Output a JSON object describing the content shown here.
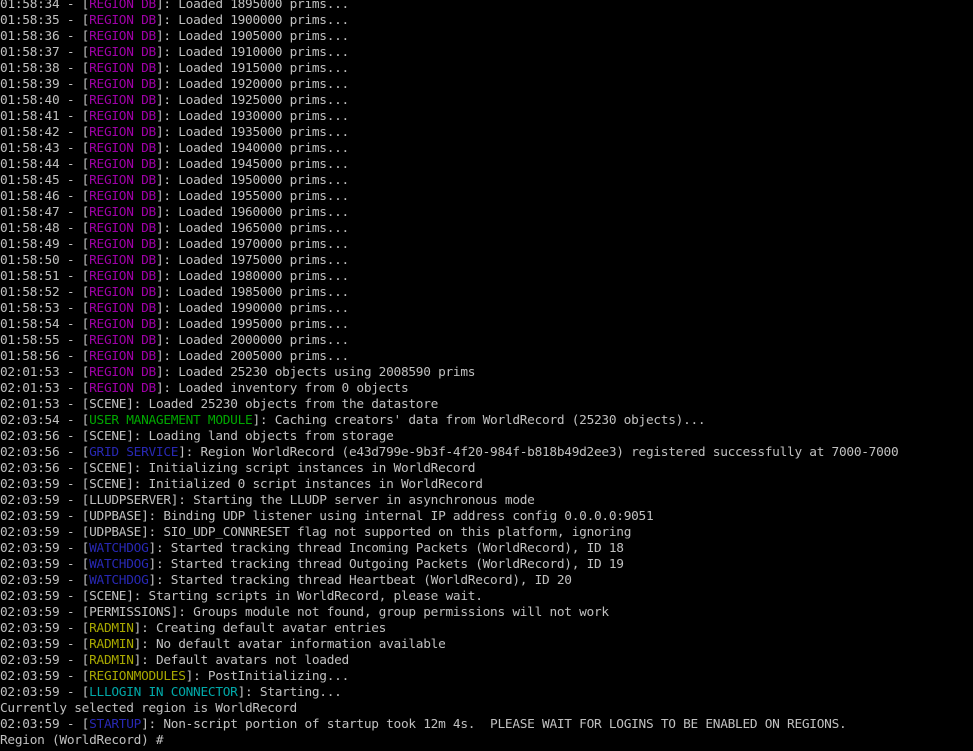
{
  "window": {
    "background": "#000000",
    "default_text_color": "#c0c0c0"
  },
  "colors": {
    "default": "#c0c0c0",
    "purple": "#a000a8",
    "green": "#00a800",
    "blue": "#2828b4",
    "yellow": "#a8a800",
    "teal": "#00a8a8"
  },
  "lines": [
    {
      "time": "01:58:34",
      "tag": "REGION DB",
      "tag_color": "purple",
      "msg": ": Loaded 1895000 prims..."
    },
    {
      "time": "01:58:35",
      "tag": "REGION DB",
      "tag_color": "purple",
      "msg": ": Loaded 1900000 prims..."
    },
    {
      "time": "01:58:36",
      "tag": "REGION DB",
      "tag_color": "purple",
      "msg": ": Loaded 1905000 prims..."
    },
    {
      "time": "01:58:37",
      "tag": "REGION DB",
      "tag_color": "purple",
      "msg": ": Loaded 1910000 prims..."
    },
    {
      "time": "01:58:38",
      "tag": "REGION DB",
      "tag_color": "purple",
      "msg": ": Loaded 1915000 prims..."
    },
    {
      "time": "01:58:39",
      "tag": "REGION DB",
      "tag_color": "purple",
      "msg": ": Loaded 1920000 prims..."
    },
    {
      "time": "01:58:40",
      "tag": "REGION DB",
      "tag_color": "purple",
      "msg": ": Loaded 1925000 prims..."
    },
    {
      "time": "01:58:41",
      "tag": "REGION DB",
      "tag_color": "purple",
      "msg": ": Loaded 1930000 prims..."
    },
    {
      "time": "01:58:42",
      "tag": "REGION DB",
      "tag_color": "purple",
      "msg": ": Loaded 1935000 prims..."
    },
    {
      "time": "01:58:43",
      "tag": "REGION DB",
      "tag_color": "purple",
      "msg": ": Loaded 1940000 prims..."
    },
    {
      "time": "01:58:44",
      "tag": "REGION DB",
      "tag_color": "purple",
      "msg": ": Loaded 1945000 prims..."
    },
    {
      "time": "01:58:45",
      "tag": "REGION DB",
      "tag_color": "purple",
      "msg": ": Loaded 1950000 prims..."
    },
    {
      "time": "01:58:46",
      "tag": "REGION DB",
      "tag_color": "purple",
      "msg": ": Loaded 1955000 prims..."
    },
    {
      "time": "01:58:47",
      "tag": "REGION DB",
      "tag_color": "purple",
      "msg": ": Loaded 1960000 prims..."
    },
    {
      "time": "01:58:48",
      "tag": "REGION DB",
      "tag_color": "purple",
      "msg": ": Loaded 1965000 prims..."
    },
    {
      "time": "01:58:49",
      "tag": "REGION DB",
      "tag_color": "purple",
      "msg": ": Loaded 1970000 prims..."
    },
    {
      "time": "01:58:50",
      "tag": "REGION DB",
      "tag_color": "purple",
      "msg": ": Loaded 1975000 prims..."
    },
    {
      "time": "01:58:51",
      "tag": "REGION DB",
      "tag_color": "purple",
      "msg": ": Loaded 1980000 prims..."
    },
    {
      "time": "01:58:52",
      "tag": "REGION DB",
      "tag_color": "purple",
      "msg": ": Loaded 1985000 prims..."
    },
    {
      "time": "01:58:53",
      "tag": "REGION DB",
      "tag_color": "purple",
      "msg": ": Loaded 1990000 prims..."
    },
    {
      "time": "01:58:54",
      "tag": "REGION DB",
      "tag_color": "purple",
      "msg": ": Loaded 1995000 prims..."
    },
    {
      "time": "01:58:55",
      "tag": "REGION DB",
      "tag_color": "purple",
      "msg": ": Loaded 2000000 prims..."
    },
    {
      "time": "01:58:56",
      "tag": "REGION DB",
      "tag_color": "purple",
      "msg": ": Loaded 2005000 prims..."
    },
    {
      "time": "02:01:53",
      "tag": "REGION DB",
      "tag_color": "purple",
      "msg": ": Loaded 25230 objects using 2008590 prims"
    },
    {
      "time": "02:01:53",
      "tag": "REGION DB",
      "tag_color": "purple",
      "msg": ": Loaded inventory from 0 objects"
    },
    {
      "time": "02:01:53",
      "tag": "SCENE",
      "tag_color": "default",
      "msg": ": Loaded 25230 objects from the datastore"
    },
    {
      "time": "02:03:54",
      "tag": "USER MANAGEMENT MODULE",
      "tag_color": "green",
      "msg": ": Caching creators' data from WorldRecord (25230 objects)..."
    },
    {
      "time": "02:03:56",
      "tag": "SCENE",
      "tag_color": "default",
      "msg": ": Loading land objects from storage"
    },
    {
      "time": "02:03:56",
      "tag": "GRID SERVICE",
      "tag_color": "blue",
      "msg": ": Region WorldRecord (e43d799e-9b3f-4f20-984f-b818b49d2ee3) registered successfully at 7000-7000"
    },
    {
      "time": "02:03:56",
      "tag": "SCENE",
      "tag_color": "default",
      "msg": ": Initializing script instances in WorldRecord"
    },
    {
      "time": "02:03:59",
      "tag": "SCENE",
      "tag_color": "default",
      "msg": ": Initialized 0 script instances in WorldRecord"
    },
    {
      "time": "02:03:59",
      "tag": "LLUDPSERVER",
      "tag_color": "default",
      "msg": ": Starting the LLUDP server in asynchronous mode"
    },
    {
      "time": "02:03:59",
      "tag": "UDPBASE",
      "tag_color": "default",
      "msg": ": Binding UDP listener using internal IP address config 0.0.0.0:9051"
    },
    {
      "time": "02:03:59",
      "tag": "UDPBASE",
      "tag_color": "default",
      "msg": ": SIO_UDP_CONNRESET flag not supported on this platform, ignoring"
    },
    {
      "time": "02:03:59",
      "tag": "WATCHDOG",
      "tag_color": "blue",
      "msg": ": Started tracking thread Incoming Packets (WorldRecord), ID 18"
    },
    {
      "time": "02:03:59",
      "tag": "WATCHDOG",
      "tag_color": "blue",
      "msg": ": Started tracking thread Outgoing Packets (WorldRecord), ID 19"
    },
    {
      "time": "02:03:59",
      "tag": "WATCHDOG",
      "tag_color": "blue",
      "msg": ": Started tracking thread Heartbeat (WorldRecord), ID 20"
    },
    {
      "time": "02:03:59",
      "tag": "SCENE",
      "tag_color": "default",
      "msg": ": Starting scripts in WorldRecord, please wait."
    },
    {
      "time": "02:03:59",
      "tag": "PERMISSIONS",
      "tag_color": "default",
      "msg": ": Groups module not found, group permissions will not work"
    },
    {
      "time": "02:03:59",
      "tag": "RADMIN",
      "tag_color": "yellow",
      "msg": ": Creating default avatar entries"
    },
    {
      "time": "02:03:59",
      "tag": "RADMIN",
      "tag_color": "yellow",
      "msg": ": No default avatar information available"
    },
    {
      "time": "02:03:59",
      "tag": "RADMIN",
      "tag_color": "yellow",
      "msg": ": Default avatars not loaded"
    },
    {
      "time": "02:03:59",
      "tag": "REGIONMODULES",
      "tag_color": "yellow",
      "msg": ": PostInitializing..."
    },
    {
      "time": "02:03:59",
      "tag": "LLLOGIN IN CONNECTOR",
      "tag_color": "teal",
      "msg": ": Starting..."
    },
    {
      "plain": "Currently selected region is WorldRecord"
    },
    {
      "time": "02:03:59",
      "tag": "STARTUP",
      "tag_color": "blue",
      "msg": ": Non-script portion of startup took 12m 4s.  PLEASE WAIT FOR LOGINS TO BE ENABLED ON REGIONS."
    }
  ],
  "prompt": {
    "text": "Region (WorldRecord) # "
  }
}
